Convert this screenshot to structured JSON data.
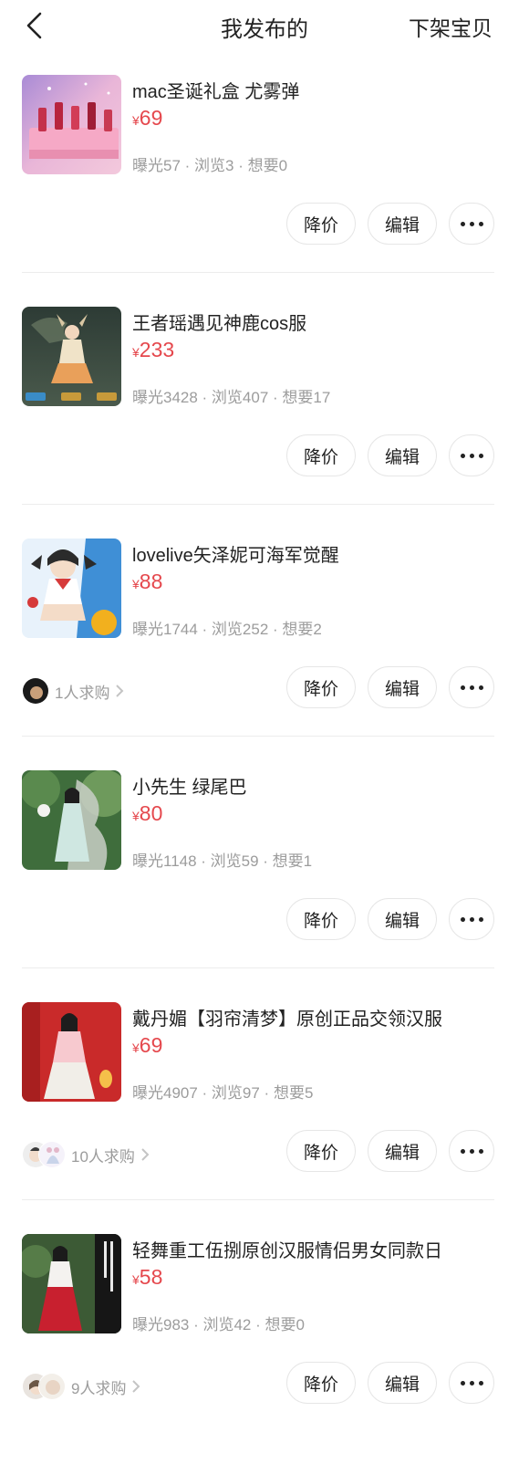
{
  "header": {
    "title": "我发布的",
    "action": "下架宝贝"
  },
  "actions": {
    "reduce_price": "降价",
    "edit": "编辑"
  },
  "items": [
    {
      "title": "mac圣诞礼盒 尤雾弹",
      "currency": "¥",
      "price": "69",
      "stats": "曝光57 · 浏览3 · 想要0",
      "buyers": "",
      "thumb": "lipstick-gift-box"
    },
    {
      "title": "王者瑶遇见神鹿cos服",
      "currency": "¥",
      "price": "233",
      "stats": "曝光3428 · 浏览407 · 想要17",
      "buyers": "",
      "thumb": "game-character-art"
    },
    {
      "title": "lovelive矢泽妮可海军觉醒",
      "currency": "¥",
      "price": "88",
      "stats": "曝光1744 · 浏览252 · 想要2",
      "buyers": "1人求购",
      "thumb": "anime-character-art"
    },
    {
      "title": "小先生  绿尾巴",
      "currency": "¥",
      "price": "80",
      "stats": "曝光1148 · 浏览59 · 想要1",
      "buyers": "",
      "thumb": "hanfu-photo-green"
    },
    {
      "title": "戴丹媚【羽帘清梦】原创正品交领汉服",
      "currency": "¥",
      "price": "69",
      "stats": "曝光4907 · 浏览97 · 想要5",
      "buyers": "10人求购",
      "thumb": "hanfu-photo-red"
    },
    {
      "title": "轻舞重工伍捌原创汉服情侣男女同款日",
      "currency": "¥",
      "price": "58",
      "stats": "曝光983 · 浏览42 · 想要0",
      "buyers": "9人求购",
      "thumb": "hanfu-photo-poster"
    }
  ]
}
